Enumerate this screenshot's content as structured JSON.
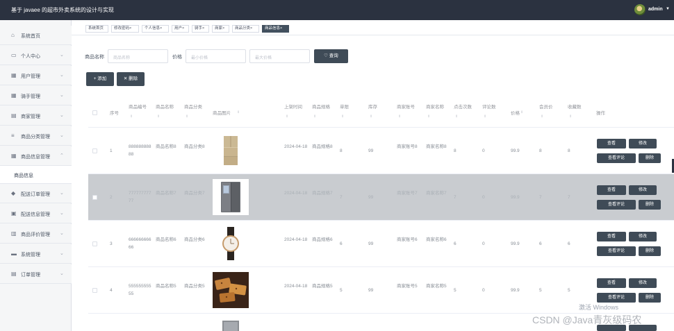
{
  "app": {
    "title": "基于 javaee 的超市外卖系统的设计与实现",
    "user": "admin",
    "caret": "▼"
  },
  "sidebar": {
    "items": [
      {
        "label": "系统首页",
        "icon": "home-icon",
        "glyph": "⌂",
        "chevron": ""
      },
      {
        "label": "个人中心",
        "icon": "user-icon",
        "glyph": "▭",
        "chevron": "⌄"
      },
      {
        "label": "用户管理",
        "icon": "grid-icon",
        "glyph": "▦",
        "chevron": "⌄"
      },
      {
        "label": "骑手管理",
        "icon": "grid-icon",
        "glyph": "▦",
        "chevron": "⌄"
      },
      {
        "label": "商家管理",
        "icon": "shop-icon",
        "glyph": "▤",
        "chevron": "⌄"
      },
      {
        "label": "商品分类管理",
        "icon": "list-icon",
        "glyph": "≡",
        "chevron": "⌄"
      },
      {
        "label": "商品信息管理",
        "icon": "grid-icon",
        "glyph": "▦",
        "chevron": "⌃"
      },
      {
        "label": "配送订单管理",
        "icon": "location-icon",
        "glyph": "◆",
        "chevron": "⌄"
      },
      {
        "label": "配送信息管理",
        "icon": "list-icon",
        "glyph": "▣",
        "chevron": "⌄"
      },
      {
        "label": "商品评价管理",
        "icon": "chart-icon",
        "glyph": "▥",
        "chevron": "⌄"
      },
      {
        "label": "系统管理",
        "icon": "settings-icon",
        "glyph": "▬",
        "chevron": "⌄"
      },
      {
        "label": "订单管理",
        "icon": "order-icon",
        "glyph": "▤",
        "chevron": "⌄"
      }
    ],
    "sub_item": "商品信息"
  },
  "tabs": [
    {
      "label": "系统首页",
      "close": ""
    },
    {
      "label": "修改密码",
      "close": "×"
    },
    {
      "label": "个人信息",
      "close": "×"
    },
    {
      "label": "用户",
      "close": "×"
    },
    {
      "label": "骑手",
      "close": "×"
    },
    {
      "label": "商家",
      "close": "×"
    },
    {
      "label": "商品分类",
      "close": "×"
    },
    {
      "label": "商品信息",
      "close": "×"
    }
  ],
  "search": {
    "name_label": "商品名称",
    "name_placeholder": "商品名称",
    "price_label": "价格",
    "min_placeholder": "最小价格",
    "max_placeholder": "最大价格",
    "query_button": "♡ 查询"
  },
  "toolbar": {
    "add": "+ 添加",
    "delete": "✕ 删除"
  },
  "table": {
    "headers": [
      "序号",
      "商品编号",
      "商品名称",
      "商品分类",
      "商品图片",
      "上架时间",
      "商品规格",
      "单限",
      "库存",
      "商家账号",
      "商家名称",
      "点击次数",
      "评论数",
      "价格",
      "会员价",
      "收藏数",
      "操作"
    ],
    "sort_glyph": "⇕",
    "rows": [
      {
        "idx": "1",
        "code": "88888888888",
        "name": "商品名称8",
        "cat": "商品分类8",
        "image": "fridge-product-image",
        "date": "2024-04-18",
        "spec": "商品规格8",
        "limit": "8",
        "stock": "99",
        "acct": "商家账号8",
        "shop": "商家名称8",
        "clicks": "8",
        "comments": "0",
        "price": "99.9",
        "vip": "8",
        "fav": "8"
      },
      {
        "idx": "2",
        "code": "77777777777",
        "name": "商品名称7",
        "cat": "商品分类7",
        "image": "fridge-display-product-image",
        "date": "2024-04-18",
        "spec": "商品规格7",
        "limit": "7",
        "stock": "99",
        "acct": "商家账号7",
        "shop": "商家名称7",
        "clicks": "7",
        "comments": "0",
        "price": "99.9",
        "vip": "7",
        "fav": "7"
      },
      {
        "idx": "3",
        "code": "66666666666",
        "name": "商品名称6",
        "cat": "商品分类6",
        "image": "watch-product-image",
        "date": "2024-04-18",
        "spec": "商品规格6",
        "limit": "6",
        "stock": "99",
        "acct": "商家账号6",
        "shop": "商家名称6",
        "clicks": "6",
        "comments": "0",
        "price": "99.9",
        "vip": "6",
        "fav": "6"
      },
      {
        "idx": "4",
        "code": "55555555555",
        "name": "商品名称5",
        "cat": "商品分类5",
        "image": "pastry-product-image",
        "date": "2024-04-18",
        "spec": "商品规格5",
        "limit": "5",
        "stock": "99",
        "acct": "商家账号5",
        "shop": "商家名称5",
        "clicks": "5",
        "comments": "0",
        "price": "99.9",
        "vip": "5",
        "fav": "5"
      }
    ],
    "actions": {
      "view": "查看",
      "edit": "修改",
      "view_comments": "查看评论",
      "delete": "删除"
    }
  },
  "overlay": {
    "activate": "激活 Windows",
    "csdn": "CSDN @Java青灰级码农"
  }
}
